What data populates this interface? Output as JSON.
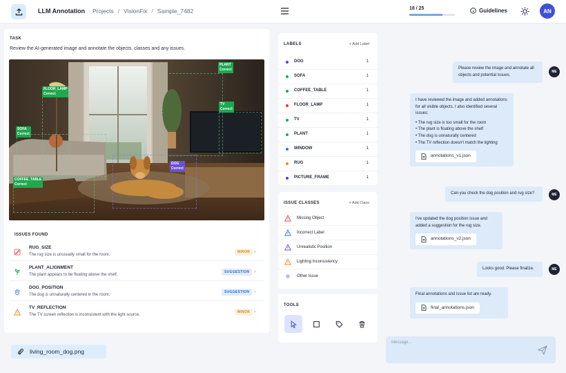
{
  "header": {
    "app_title": "LLM Annotation",
    "breadcrumb": [
      "Projects",
      "VisionFix",
      "Sample_7482"
    ],
    "progress_text": "18 / 25",
    "progress_fraction": 0.72,
    "guidelines_label": "Guidelines",
    "avatar_initials": "AN"
  },
  "task": {
    "label": "TASK",
    "text": "Review the AI-generated image and annotate the objects, classes and any issues."
  },
  "annotations": [
    {
      "label": "FLOOR_LAMP",
      "status": "Correct"
    },
    {
      "label": "PLANT",
      "status": "Correct"
    },
    {
      "label": "TV",
      "status": "Correct"
    },
    {
      "label": "SOFA",
      "status": "Correct"
    },
    {
      "label": "DOG",
      "status": "Correct"
    },
    {
      "label": "COFFEE_TABLE",
      "status": "Correct"
    }
  ],
  "issues": {
    "title": "ISSUES FOUND",
    "items": [
      {
        "title": "RUG_SIZE",
        "desc": "The rug size is unusually small for the room.",
        "badge": "MINOR"
      },
      {
        "title": "PLANT_ALIGNMENT",
        "desc": "The plant appears to be floating above the shelf.",
        "badge": "SUGGESTION"
      },
      {
        "title": "DOG_POSITION",
        "desc": "The dog is unnaturally centered in the room.",
        "badge": "SUGGESTION"
      },
      {
        "title": "TV_REFLECTION",
        "desc": "The TV screen reflection is inconsistent with the light source.",
        "badge": "MINOR"
      }
    ]
  },
  "file_chip": "living_room_dog.png",
  "labels_panel": {
    "title": "LABELS",
    "add_label": "+ Add Label",
    "items": [
      {
        "name": "DOG",
        "count": "1",
        "color": "#5b3fd8"
      },
      {
        "name": "SOFA",
        "count": "1",
        "color": "#1fa84f"
      },
      {
        "name": "COFFEE_TABLE",
        "count": "1",
        "color": "#1fa84f"
      },
      {
        "name": "FLOOR_LAMP",
        "count": "1",
        "color": "#d83a3a"
      },
      {
        "name": "TV",
        "count": "1",
        "color": "#1fa84f"
      },
      {
        "name": "PLANT",
        "count": "1",
        "color": "#1fa84f"
      },
      {
        "name": "WINDOW",
        "count": "1",
        "color": "#3a6fd8"
      },
      {
        "name": "RUG",
        "count": "1",
        "color": "#f08a1f"
      },
      {
        "name": "PICTURE_FRAME",
        "count": "1",
        "color": "#5b3fd8"
      }
    ]
  },
  "issue_classes": {
    "title": "ISSUE CLASSES",
    "add_class": "+ Add Class",
    "items": [
      {
        "name": "Missing Object",
        "color": "#e04848"
      },
      {
        "name": "Incorrect Label",
        "color": "#3a6fd8"
      },
      {
        "name": "Unrealistic Position",
        "color": "#6a4fd8"
      },
      {
        "name": "Lighting Inconsistency",
        "color": "#f08a1f"
      },
      {
        "name": "Other Issue",
        "color": "#7a84e8"
      }
    ]
  },
  "tools": {
    "title": "TOOLS"
  },
  "chat": {
    "me_label": "ME",
    "msg1": "Please review the image and annotate all objects and potential issues.",
    "msg2_intro": "I have reviewed the image and added annotations for all visible objects. I also identified several issues:",
    "msg2_list": [
      "The rug size is too small for the room",
      "The plant is floating above the shelf",
      "The dog is unnaturally centered",
      "The TV reflection doesn't match the lighting"
    ],
    "msg2_file": "annotations_v1.json",
    "msg3": "Can you check the dog position and rug size?",
    "msg4": "I've updated the dog position issue and added a suggestion for the rug size.",
    "msg4_file": "annotations_v2.json",
    "msg5": "Looks good. Please finalize.",
    "msg6": "Final annotations and issue list are ready.",
    "msg6_file": "final_annotations.json",
    "composer_placeholder": "Message..."
  }
}
